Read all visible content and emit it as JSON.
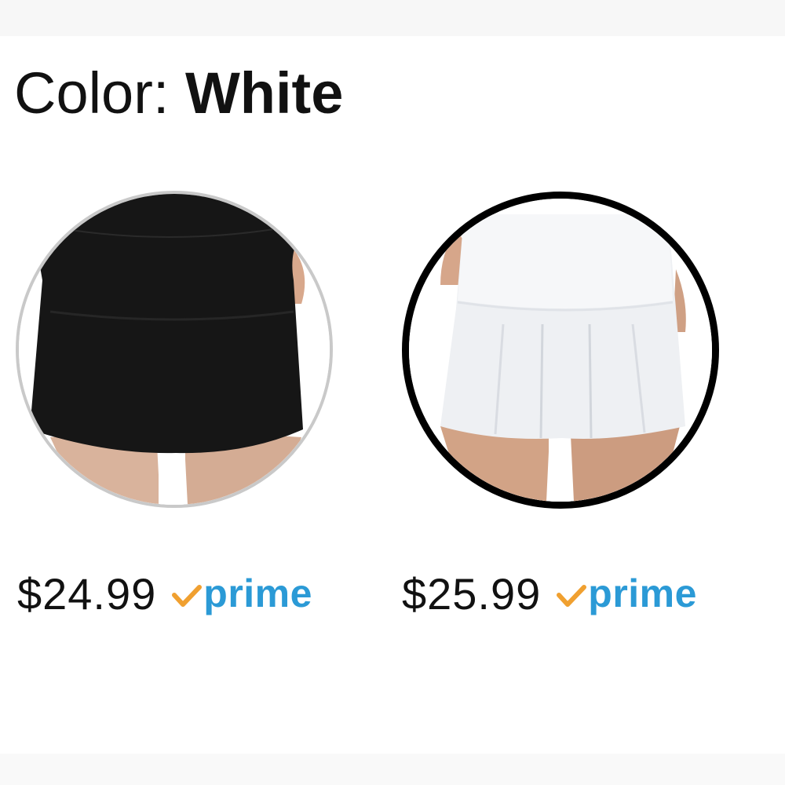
{
  "selector": {
    "label": "Color: ",
    "selected_value": "White"
  },
  "swatches": [
    {
      "name": "Black",
      "price": "$24.99",
      "prime_label": "prime",
      "selected": false
    },
    {
      "name": "White",
      "price": "$25.99",
      "prime_label": "prime",
      "selected": true
    }
  ],
  "colors": {
    "prime_blue": "#2b9ad6",
    "prime_check": "#f0a030",
    "selected_border": "#000000",
    "unselected_border": "#c9c9c9"
  },
  "icons": {
    "prime_check": "checkmark-icon"
  }
}
